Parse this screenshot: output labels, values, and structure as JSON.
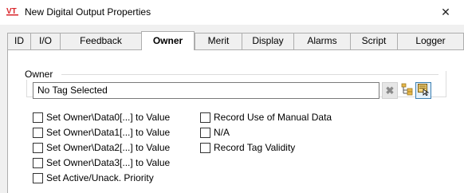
{
  "window": {
    "title": "New Digital Output Properties",
    "close_glyph": "✕",
    "icon": "vt-app-icon",
    "icon_color": "#d9262b"
  },
  "tabs": [
    {
      "label": "ID"
    },
    {
      "label": "I/O"
    },
    {
      "label": "Feedback"
    },
    {
      "label": "Owner",
      "active": true
    },
    {
      "label": "Merit"
    },
    {
      "label": "Display"
    },
    {
      "label": "Alarms"
    },
    {
      "label": "Script"
    },
    {
      "label": "Logger"
    }
  ],
  "owner": {
    "group_label": "Owner",
    "tag_value": "No Tag Selected",
    "buttons": {
      "clear": {
        "icon": "clear-icon",
        "glyph": "✖"
      },
      "tree": {
        "icon": "tag-tree-icon"
      },
      "select": {
        "icon": "select-tag-icon"
      }
    }
  },
  "options_left": [
    {
      "label": "Set Owner\\Data0[...] to Value",
      "checked": false
    },
    {
      "label": "Set Owner\\Data1[...] to Value",
      "checked": false
    },
    {
      "label": "Set Owner\\Data2[...] to Value",
      "checked": false
    },
    {
      "label": "Set Owner\\Data3[...] to Value",
      "checked": false
    },
    {
      "label": "Set Active/Unack. Priority",
      "checked": false
    }
  ],
  "options_right": [
    {
      "label": "Record Use of Manual Data",
      "checked": false
    },
    {
      "label": "N/A",
      "checked": false
    },
    {
      "label": "Record Tag Validity",
      "checked": false
    }
  ]
}
